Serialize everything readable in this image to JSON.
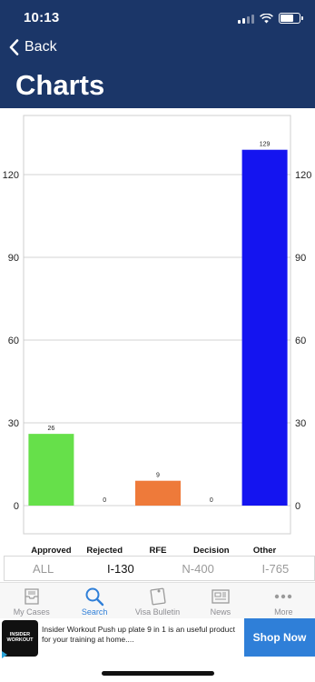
{
  "status_bar": {
    "time": "10:13"
  },
  "nav": {
    "back_label": "Back",
    "title": "Charts"
  },
  "chart_data": {
    "type": "bar",
    "categories": [
      "Approved",
      "Rejected",
      "RFE",
      "Decision",
      "Other"
    ],
    "values": [
      26,
      0,
      9,
      0,
      129
    ],
    "colors": [
      "#66e04a",
      "#7a7a7a",
      "#ee7a3a",
      "#7a7a7a",
      "#1414f0"
    ],
    "ylim": [
      0,
      135
    ],
    "yticks": [
      0,
      30,
      60,
      90,
      120
    ],
    "grid": true,
    "right_axis": true
  },
  "segment": {
    "items": [
      "ALL",
      "I-130",
      "N-400",
      "I-765"
    ],
    "active": "I-130"
  },
  "tabbar": {
    "items": [
      {
        "label": "My Cases",
        "icon": "inbox-icon",
        "active": false
      },
      {
        "label": "Search",
        "icon": "search-icon",
        "active": true
      },
      {
        "label": "Visa Bulletin",
        "icon": "bulletin-icon",
        "active": false
      },
      {
        "label": "News",
        "icon": "newspaper-icon",
        "active": false
      },
      {
        "label": "More",
        "icon": "more-icon",
        "active": false
      }
    ]
  },
  "ad": {
    "image_text": "INSIDER WORKOUT",
    "text": "Insider Workout Push up plate 9 in 1 is an useful product for your training at home....",
    "button_label": "Shop Now"
  },
  "colors": {
    "header_bg": "#1b3668",
    "accent": "#2f7fd8"
  }
}
